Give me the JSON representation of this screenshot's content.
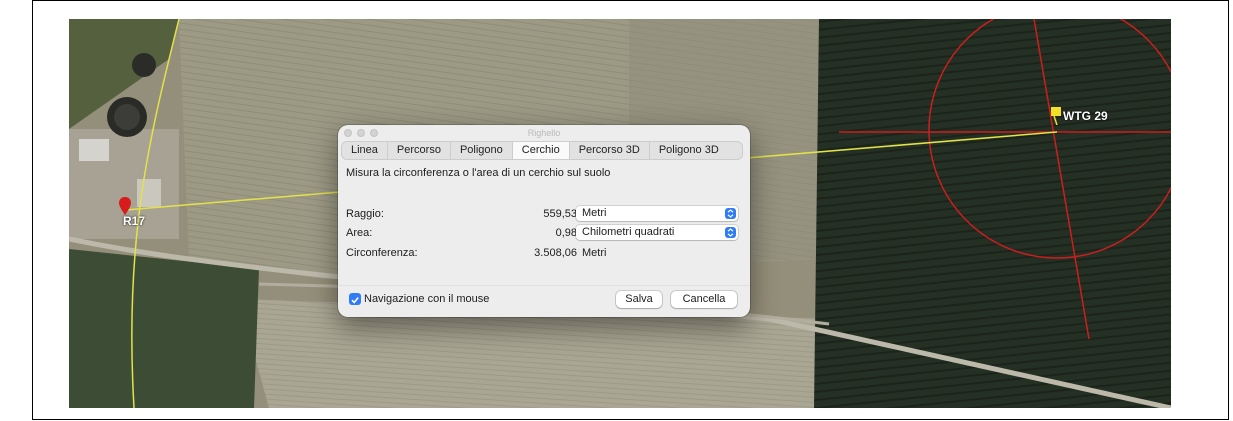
{
  "window": {
    "title": "Righello"
  },
  "tabs": [
    "Linea",
    "Percorso",
    "Poligono",
    "Cerchio",
    "Percorso 3D",
    "Poligono 3D"
  ],
  "active_tab": "Cerchio",
  "description": "Misura la circonferenza o l'area di un cerchio sul suolo",
  "rows": {
    "raggio": {
      "label": "Raggio:",
      "value": "559,53",
      "unit": "Metri"
    },
    "area": {
      "label": "Area:",
      "value": "0,98",
      "unit": "Chilometri quadrati"
    },
    "circonferenza": {
      "label": "Circonferenza:",
      "value": "3.508,06",
      "unit": "Metri"
    }
  },
  "mouse_nav": {
    "label": "Navigazione con il mouse",
    "checked": true
  },
  "buttons": {
    "save": "Salva",
    "cancel": "Cancella"
  },
  "placemarks": {
    "left": "R17",
    "right": "WTG 29"
  },
  "colors": {
    "accent": "#2f7cf6",
    "measure_line": "#e3e24a",
    "circle": "#cc1e1e",
    "pin_red": "#d81b1b",
    "pin_yellow": "#f1df2a"
  }
}
